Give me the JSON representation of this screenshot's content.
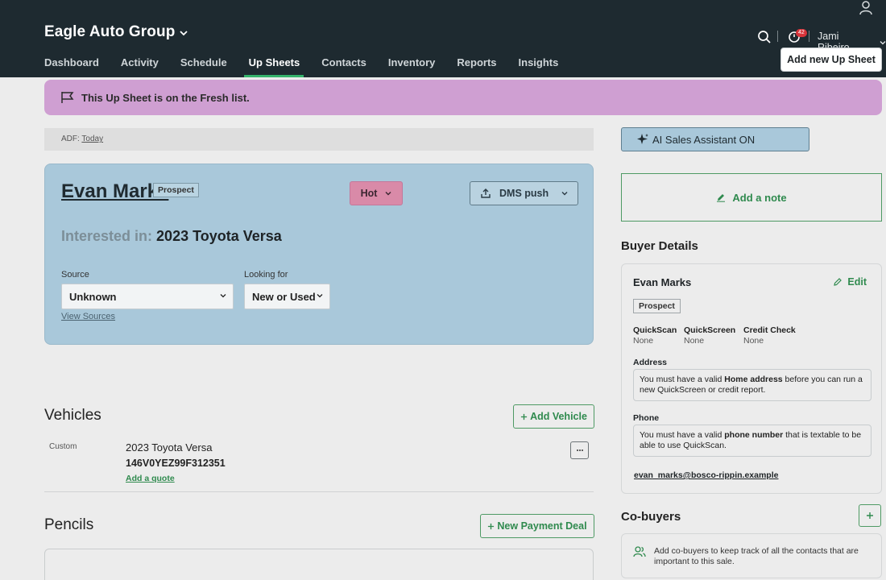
{
  "header": {
    "brand": "Eagle Auto Group",
    "nav": [
      "Dashboard",
      "Activity",
      "Schedule",
      "Up Sheets",
      "Contacts",
      "Inventory",
      "Reports",
      "Insights"
    ],
    "active_nav": "Up Sheets",
    "notification_count": "42",
    "user_name": "Jami Ribeiro",
    "add_button": "Add new Up Sheet"
  },
  "banner": {
    "text": "This Up Sheet is on the Fresh list."
  },
  "adf": {
    "label": "ADF:",
    "value": "Today"
  },
  "lead": {
    "name": "Evan Marks",
    "tag": "Prospect",
    "temperature": "Hot",
    "dms_label": "DMS push",
    "interested_label": "Interested in:",
    "interested_value": "2023 Toyota Versa",
    "source_label": "Source",
    "source_value": "Unknown",
    "looking_label": "Looking for",
    "looking_value": "New or Used",
    "view_sources": "View Sources"
  },
  "right": {
    "ai_button": "AI Sales Assistant ON",
    "add_note": "Add a note",
    "buyer_title": "Buyer Details",
    "buyer_name": "Evan Marks",
    "edit": "Edit",
    "buyer_tag": "Prospect",
    "checks": [
      {
        "label": "QuickScan",
        "value": "None"
      },
      {
        "label": "QuickScreen",
        "value": "None"
      },
      {
        "label": "Credit Check",
        "value": "None"
      }
    ],
    "address_label": "Address",
    "address_msg_1": "You must have a valid ",
    "address_msg_bold": "Home address",
    "address_msg_2": " before you can run a new QuickScreen or credit report.",
    "phone_label": "Phone",
    "phone_msg_1": "You must have a valid ",
    "phone_msg_bold": "phone number",
    "phone_msg_2": " that is textable to be able to use QuickScan.",
    "email": "evan_marks@bosco-rippin.example",
    "cobuyers_title": "Co-buyers",
    "cobuyers_msg": "Add co-buyers to keep track of all the contacts that are important to this sale."
  },
  "vehicles": {
    "title": "Vehicles",
    "add_button": "Add Vehicle",
    "items": [
      {
        "type": "Custom",
        "title": "2023 Toyota Versa",
        "vin": "146V0YEZ99F312351",
        "quote_link": "Add a quote"
      }
    ]
  },
  "pencils": {
    "title": "Pencils",
    "new_button": "New Payment Deal"
  },
  "colors": {
    "header_bg": "#1e2a30",
    "accent_green": "#2f8a4e",
    "banner": "#cf9fd2",
    "card_blue": "#a9c8da",
    "hot": "#d98aa8"
  }
}
